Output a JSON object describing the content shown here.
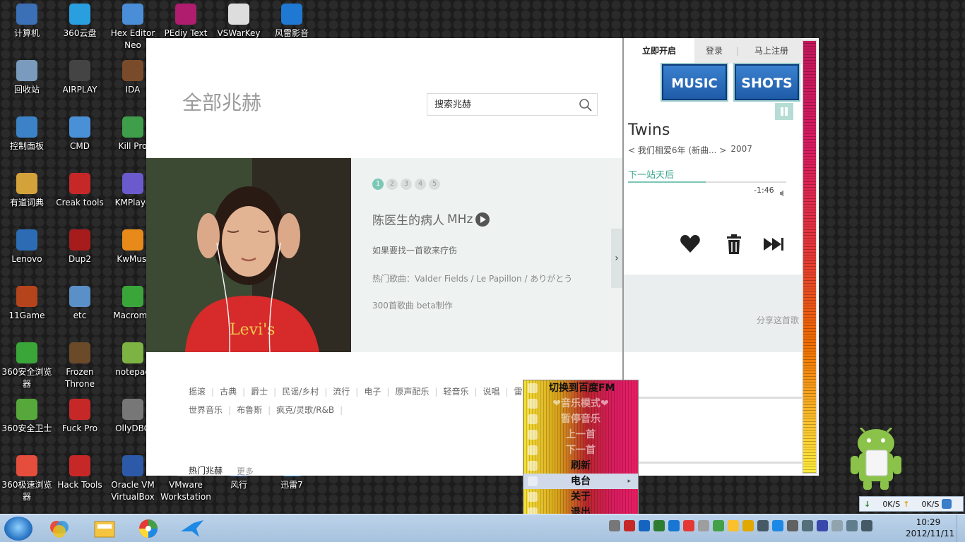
{
  "desktop": {
    "icons": [
      {
        "label": "计算机",
        "icon": "computer-icon",
        "color": "#3b6fb6"
      },
      {
        "label": "360云盘",
        "icon": "cloud-icon",
        "color": "#2a9fe0"
      },
      {
        "label": "Hex Editor Neo",
        "icon": "hex-editor-icon",
        "color": "#4a8ed8"
      },
      {
        "label": "PEdiy Text",
        "icon": "pediy-icon",
        "color": "#b01c6e"
      },
      {
        "label": "VSWarKey",
        "icon": "keyboard-icon",
        "color": "#dddddd"
      },
      {
        "label": "风雷影音",
        "icon": "player-icon",
        "color": "#1f78d1"
      },
      {
        "label": "回收站",
        "icon": "recycle-bin-icon",
        "color": "#7a9bbd"
      },
      {
        "label": "AIRPLAY",
        "icon": "airplay-icon",
        "color": "#444444"
      },
      {
        "label": "IDA",
        "icon": "ida-icon",
        "color": "#7a4b2a"
      },
      {
        "label": "控制面板",
        "icon": "control-panel-icon",
        "color": "#3b83c6"
      },
      {
        "label": "CMD",
        "icon": "cmd-icon",
        "color": "#4a90d6"
      },
      {
        "label": "Kill Pro",
        "icon": "kill-pro-icon",
        "color": "#3e9e4a"
      },
      {
        "label": "有道词典",
        "icon": "dictionary-icon",
        "color": "#d4a23a"
      },
      {
        "label": "Creak tools",
        "icon": "crack-tools-icon",
        "color": "#c62828"
      },
      {
        "label": "KMPlaye",
        "icon": "kmplayer-icon",
        "color": "#6a5acd"
      },
      {
        "label": "Lenovo",
        "icon": "lenovo-icon",
        "color": "#2b6cb5"
      },
      {
        "label": "Dup2",
        "icon": "dup2-icon",
        "color": "#a61c1c"
      },
      {
        "label": "KwMusi",
        "icon": "kwmusic-icon",
        "color": "#e88a1a"
      },
      {
        "label": "11Game",
        "icon": "game-icon",
        "color": "#b5431c"
      },
      {
        "label": "etc",
        "icon": "laptop-icon",
        "color": "#5a8fc7"
      },
      {
        "label": "Macrome",
        "icon": "dreamweaver-icon",
        "color": "#3aa63a"
      },
      {
        "label": "360安全浏览器",
        "icon": "browser-360-icon",
        "color": "#3aa63a"
      },
      {
        "label": "Frozen Throne",
        "icon": "warcraft-icon",
        "color": "#6b4a2a"
      },
      {
        "label": "notepad",
        "icon": "notepad-icon",
        "color": "#7cb342"
      },
      {
        "label": "360安全卫士",
        "icon": "security-360-icon",
        "color": "#56a83a"
      },
      {
        "label": "Fuck Pro",
        "icon": "no-icon",
        "color": "#c62828"
      },
      {
        "label": "OllyDBG",
        "icon": "ollydbg-icon",
        "color": "#777777"
      },
      {
        "label": "360极速浏览器",
        "icon": "browser-fast-icon",
        "color": "#e54d3c"
      },
      {
        "label": "Hack Tools",
        "icon": "hack-tools-icon",
        "color": "#c62828"
      },
      {
        "label": "Oracle VM VirtualBox",
        "icon": "virtualbox-icon",
        "color": "#2d5aa8"
      },
      {
        "label": "VMware Workstation",
        "icon": "vmware-icon",
        "color": "#6d6d6d"
      },
      {
        "label": "风行",
        "icon": "funshion-icon",
        "color": "#3a6fc1"
      },
      {
        "label": "迅雷7",
        "icon": "thunder-icon",
        "color": "#2a8fd6"
      }
    ]
  },
  "app": {
    "title": "全部兆赫",
    "search": {
      "placeholder": "搜索兆赫"
    },
    "banner": {
      "dots": [
        "1",
        "2",
        "3",
        "4",
        "5"
      ],
      "active_dot": 0,
      "station_name": "陈医生的病人",
      "station_unit": "MHz",
      "description": "如果要找一首歌来疗伤",
      "hot_songs": "热门歌曲：Valder Fields / Le Papillon / ありがとう",
      "meta": "300首歌曲  beta制作"
    },
    "genres": [
      "摇滚",
      "古典",
      "爵士",
      "民谣/乡村",
      "流行",
      "电子",
      "原声配乐",
      "轻音乐",
      "说唱",
      "雷",
      "世界音乐",
      "布鲁斯",
      "疯克/灵歌/R&B"
    ],
    "hot_label": "热门兆赫",
    "more_label": "更多"
  },
  "player": {
    "tabs": [
      "立即开启",
      "登录",
      "马上注册"
    ],
    "music_label": "MUSIC",
    "shots_label": "SHOTS",
    "artist": "Twins",
    "album": "< 我们相爱6年 (新曲... >",
    "year": "2007",
    "next_label": "下一站天后",
    "progress": 0.49,
    "time": "-1:46",
    "share_label": "分享这首歌",
    "accent": "#7cc7b5"
  },
  "context_menu": {
    "items": [
      {
        "label": "切换到百度FM",
        "icon": "switch-icon",
        "state": "normal"
      },
      {
        "label": "❤音乐模式❤",
        "icon": "heart-mode-icon",
        "state": "disabled"
      },
      {
        "label": "暂停音乐",
        "icon": "pause-icon",
        "state": "disabled"
      },
      {
        "label": "上一首",
        "icon": "prev-icon",
        "state": "disabled"
      },
      {
        "label": "下一首",
        "icon": "next-icon",
        "state": "disabled"
      },
      {
        "label": "刷新",
        "icon": "refresh-icon",
        "state": "normal"
      },
      {
        "label": "电台",
        "icon": "radio-icon",
        "state": "highlight"
      },
      {
        "label": "关于",
        "icon": "info-icon",
        "state": "normal"
      },
      {
        "label": "退出",
        "icon": "exit-icon",
        "state": "normal"
      }
    ]
  },
  "netspeed": {
    "down": "0K/S",
    "up": "0K/S"
  },
  "taskbar": {
    "time": "10:29",
    "date": "2012/11/11",
    "apps": [
      "explorer-folder",
      "color-wheel-app",
      "bird-app"
    ]
  }
}
